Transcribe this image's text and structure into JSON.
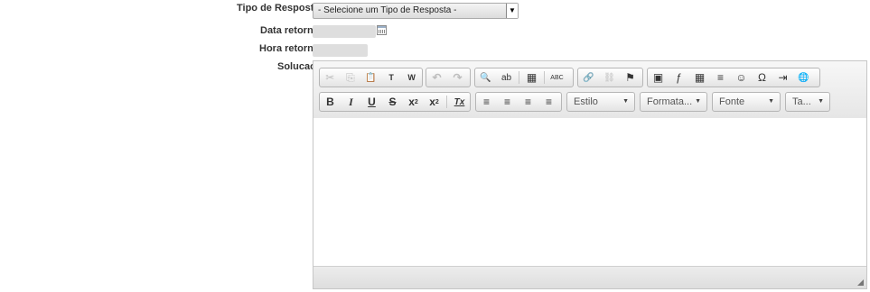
{
  "form": {
    "tipo_label": "Tipo de Resposta",
    "tipo_value": "- Selecione um Tipo de Resposta -",
    "data_label": "Data retorno",
    "hora_label": "Hora retorno",
    "solucao_label": "Solucao"
  },
  "editor": {
    "combos": {
      "estilo": "Estilo",
      "formatacao": "Formata...",
      "fonte": "Fonte",
      "tamanho": "Ta..."
    }
  },
  "icons": {
    "cut": "✂",
    "copy": "⎘",
    "paste": "📋",
    "paste_text": "T",
    "paste_word": "W",
    "undo": "↶",
    "redo": "↷",
    "find": "🔍",
    "replace": "ab",
    "select_all": "▦",
    "spell": "ABC",
    "link": "🔗",
    "unlink": "⛓",
    "anchor": "⚑",
    "image": "▣",
    "flash": "ƒ",
    "table": "▦",
    "hr": "≡",
    "smiley": "☺",
    "special": "Ω",
    "pagebreak": "⇥",
    "iframe": "🌐",
    "bold": "B",
    "italic": "I",
    "underline": "U",
    "strike": "S",
    "subscript": "x",
    "superscript": "x",
    "remove_format": "Tx",
    "align_left": "≡",
    "align_center": "≡",
    "align_right": "≡",
    "justify": "≡"
  }
}
